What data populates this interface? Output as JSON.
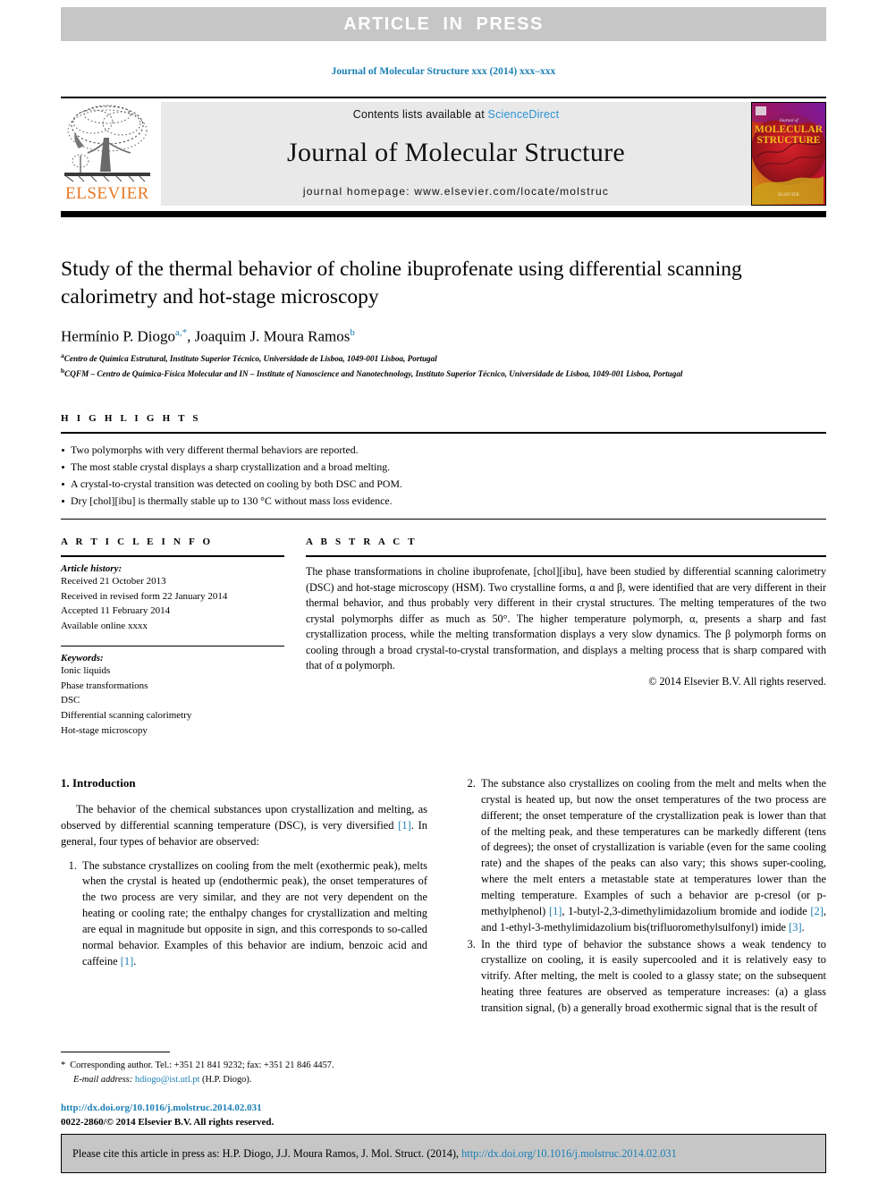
{
  "banner": {
    "text": "ARTICLE  IN  PRESS"
  },
  "journal_ref": "Journal of Molecular Structure xxx (2014) xxx–xxx",
  "masthead": {
    "contents_prefix": "Contents lists available at ",
    "sciencedirect": "ScienceDirect",
    "journal_title": "Journal of Molecular Structure",
    "homepage": "journal homepage: www.elsevier.com/locate/molstruc",
    "publisher_name": "ELSEVIER",
    "cover_title_small": "Journal of",
    "cover_title_line1": "MOLECULAR",
    "cover_title_line2": "STRUCTURE"
  },
  "article": {
    "title": "Study of the thermal behavior of choline ibuprofenate using differential scanning calorimetry and hot-stage microscopy",
    "authors_part1": "Hermínio P. Diogo",
    "authors_sup1": "a,*",
    "authors_part2": ", Joaquim J. Moura Ramos",
    "authors_sup2": "b",
    "affiliation_a_sup": "a",
    "affiliation_a": "Centro de Química Estrutural, Instituto Superior Técnico, Universidade de Lisboa, 1049-001 Lisboa, Portugal",
    "affiliation_b_sup": "b",
    "affiliation_b": "CQFM – Centro de Química-Física Molecular and IN – Institute of Nanoscience and Nanotechnology, Instituto Superior Técnico, Universidade de Lisboa, 1049-001 Lisboa, Portugal"
  },
  "highlights": {
    "heading": "H I G H L I G H T S",
    "items": [
      "Two polymorphs with very different thermal behaviors are reported.",
      "The most stable crystal displays a sharp crystallization and a broad melting.",
      "A crystal-to-crystal transition was detected on cooling by both DSC and POM.",
      "Dry [chol][ibu] is thermally stable up to 130 °C without mass loss evidence."
    ]
  },
  "article_info": {
    "heading": "A R T I C L E   I N F O",
    "history_label": "Article history:",
    "history": [
      "Received 21 October 2013",
      "Received in revised form 22 January 2014",
      "Accepted 11 February 2014",
      "Available online xxxx"
    ],
    "keywords_label": "Keywords:",
    "keywords": [
      "Ionic liquids",
      "Phase transformations",
      "DSC",
      "Differential scanning calorimetry",
      "Hot-stage microscopy"
    ]
  },
  "abstract": {
    "heading": "A B S T R A C T",
    "body": "The phase transformations in choline ibuprofenate, [chol][ibu], have been studied by differential scanning calorimetry (DSC) and hot-stage microscopy (HSM). Two crystalline forms, α and β, were identified that are very different in their thermal behavior, and thus probably very different in their crystal structures. The melting temperatures of the two crystal polymorphs differ as much as 50°. The higher temperature polymorph, α, presents a sharp and fast crystallization process, while the melting transformation displays a very slow dynamics. The β polymorph forms on cooling through a broad crystal-to-crystal transformation, and displays a melting process that is sharp compared with that of α polymorph.",
    "copyright": "© 2014 Elsevier B.V. All rights reserved."
  },
  "introduction": {
    "heading": "1. Introduction",
    "para1_a": "The behavior of the chemical substances upon crystallization and melting, as observed by differential scanning temperature (DSC), is very diversified ",
    "para1_ref": "[1]",
    "para1_b": ". In general, four types of behavior are observed:",
    "item1_a": "The substance crystallizes on cooling from the melt (exothermic peak), melts when the crystal is heated up (endothermic peak), the onset temperatures of the two process are very similar, and they are not very dependent on the heating or cooling rate; the enthalpy changes for crystallization and melting are equal in magnitude but opposite in sign, and this corresponds to so-called normal behavior. Examples of this behavior are indium, benzoic acid and caffeine ",
    "item1_ref": "[1]",
    "item1_b": ".",
    "item2_a": "The substance also crystallizes on cooling from the melt and melts when the crystal is heated up, but now the onset temperatures of the two process are different; the onset temperature of the crystallization peak is lower than that of the melting peak, and these temperatures can be markedly different (tens of degrees); the onset of crystallization is variable (even for the same cooling rate) and the shapes of the peaks can also vary; this shows super-cooling, where the melt enters a metastable state at temperatures lower than the melting temperature. Examples of such a behavior are p-cresol (or p-methylphenol) ",
    "item2_ref1": "[1]",
    "item2_b": ", 1-butyl-2,3-dimethylimidazolium bromide and iodide ",
    "item2_ref2": "[2]",
    "item2_c": ", and 1-ethyl-3-methylimidazolium bis(trifluoromethylsulfonyl) imide ",
    "item2_ref3": "[3]",
    "item2_d": ".",
    "item3": "In the third type of behavior the substance shows a weak tendency to crystallize on cooling, it is easily supercooled and it is relatively easy to vitrify. After melting, the melt is cooled to a glassy state; on the subsequent heating three features are observed as temperature increases: (a) a glass transition signal, (b) a generally broad exothermic signal that is the result of"
  },
  "footnote": {
    "star": "*",
    "corresponding": "Corresponding author. Tel.: +351 21 841 9232; fax: +351 21 846 4457.",
    "email_label": "E-mail address:",
    "email": "hdiogo@ist.utl.pt",
    "email_owner": "(H.P. Diogo).",
    "doi": "http://dx.doi.org/10.1016/j.molstruc.2014.02.031",
    "issn": "0022-2860/© 2014 Elsevier B.V. All rights reserved."
  },
  "cite_bar": {
    "prefix": "Please cite this article in press as: H.P. Diogo, J.J. Moura Ramos, J. Mol. Struct. (2014), ",
    "link": "http://dx.doi.org/10.1016/j.molstruc.2014.02.031"
  },
  "colors": {
    "link_blue": "#1a7fb5",
    "sciencedirect_blue": "#2a93d4",
    "elsevier_orange": "#e87722",
    "banner_gray": "#c6c6c6",
    "panel_gray": "#e9e9e9"
  }
}
